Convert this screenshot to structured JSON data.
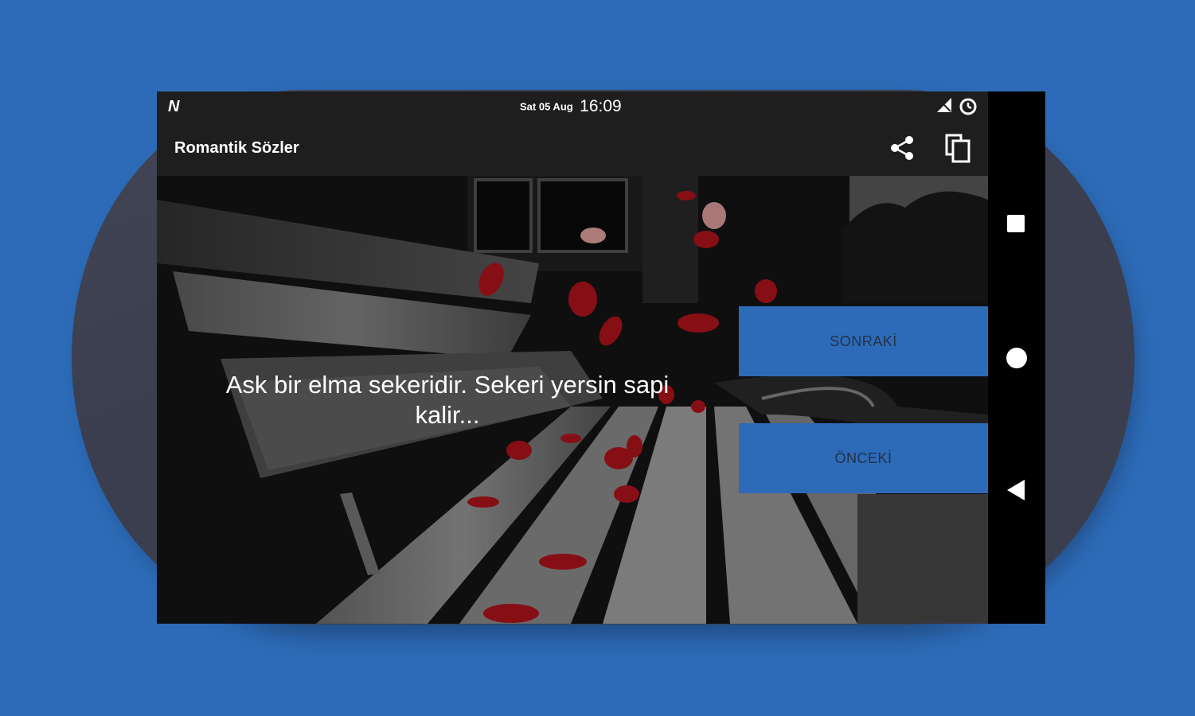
{
  "colors": {
    "background": "#2d6bb8",
    "accent_button": "#2d6bb8",
    "button_text": "#23324a",
    "toolbar": "#1e1e1e"
  },
  "status_bar": {
    "app_icon": "n-notification-icon",
    "date": "Sat 05 Aug",
    "time": "16:09",
    "icons": [
      "signal-icon",
      "alarm-clock-icon"
    ]
  },
  "app_bar": {
    "title": "Romantik Sözler",
    "actions": [
      {
        "icon": "share-icon"
      },
      {
        "icon": "copy-icon"
      }
    ]
  },
  "content": {
    "quote": "Ask bir elma sekeridir. Sekeri yersin sapi kalir...",
    "background": "bench-rose-petals-photo"
  },
  "buttons": {
    "next_label": "SONRAKİ",
    "previous_label": "ÖNCEKİ"
  },
  "nav_bar": {
    "icons": [
      "recent-apps-icon",
      "home-icon",
      "back-icon"
    ]
  }
}
